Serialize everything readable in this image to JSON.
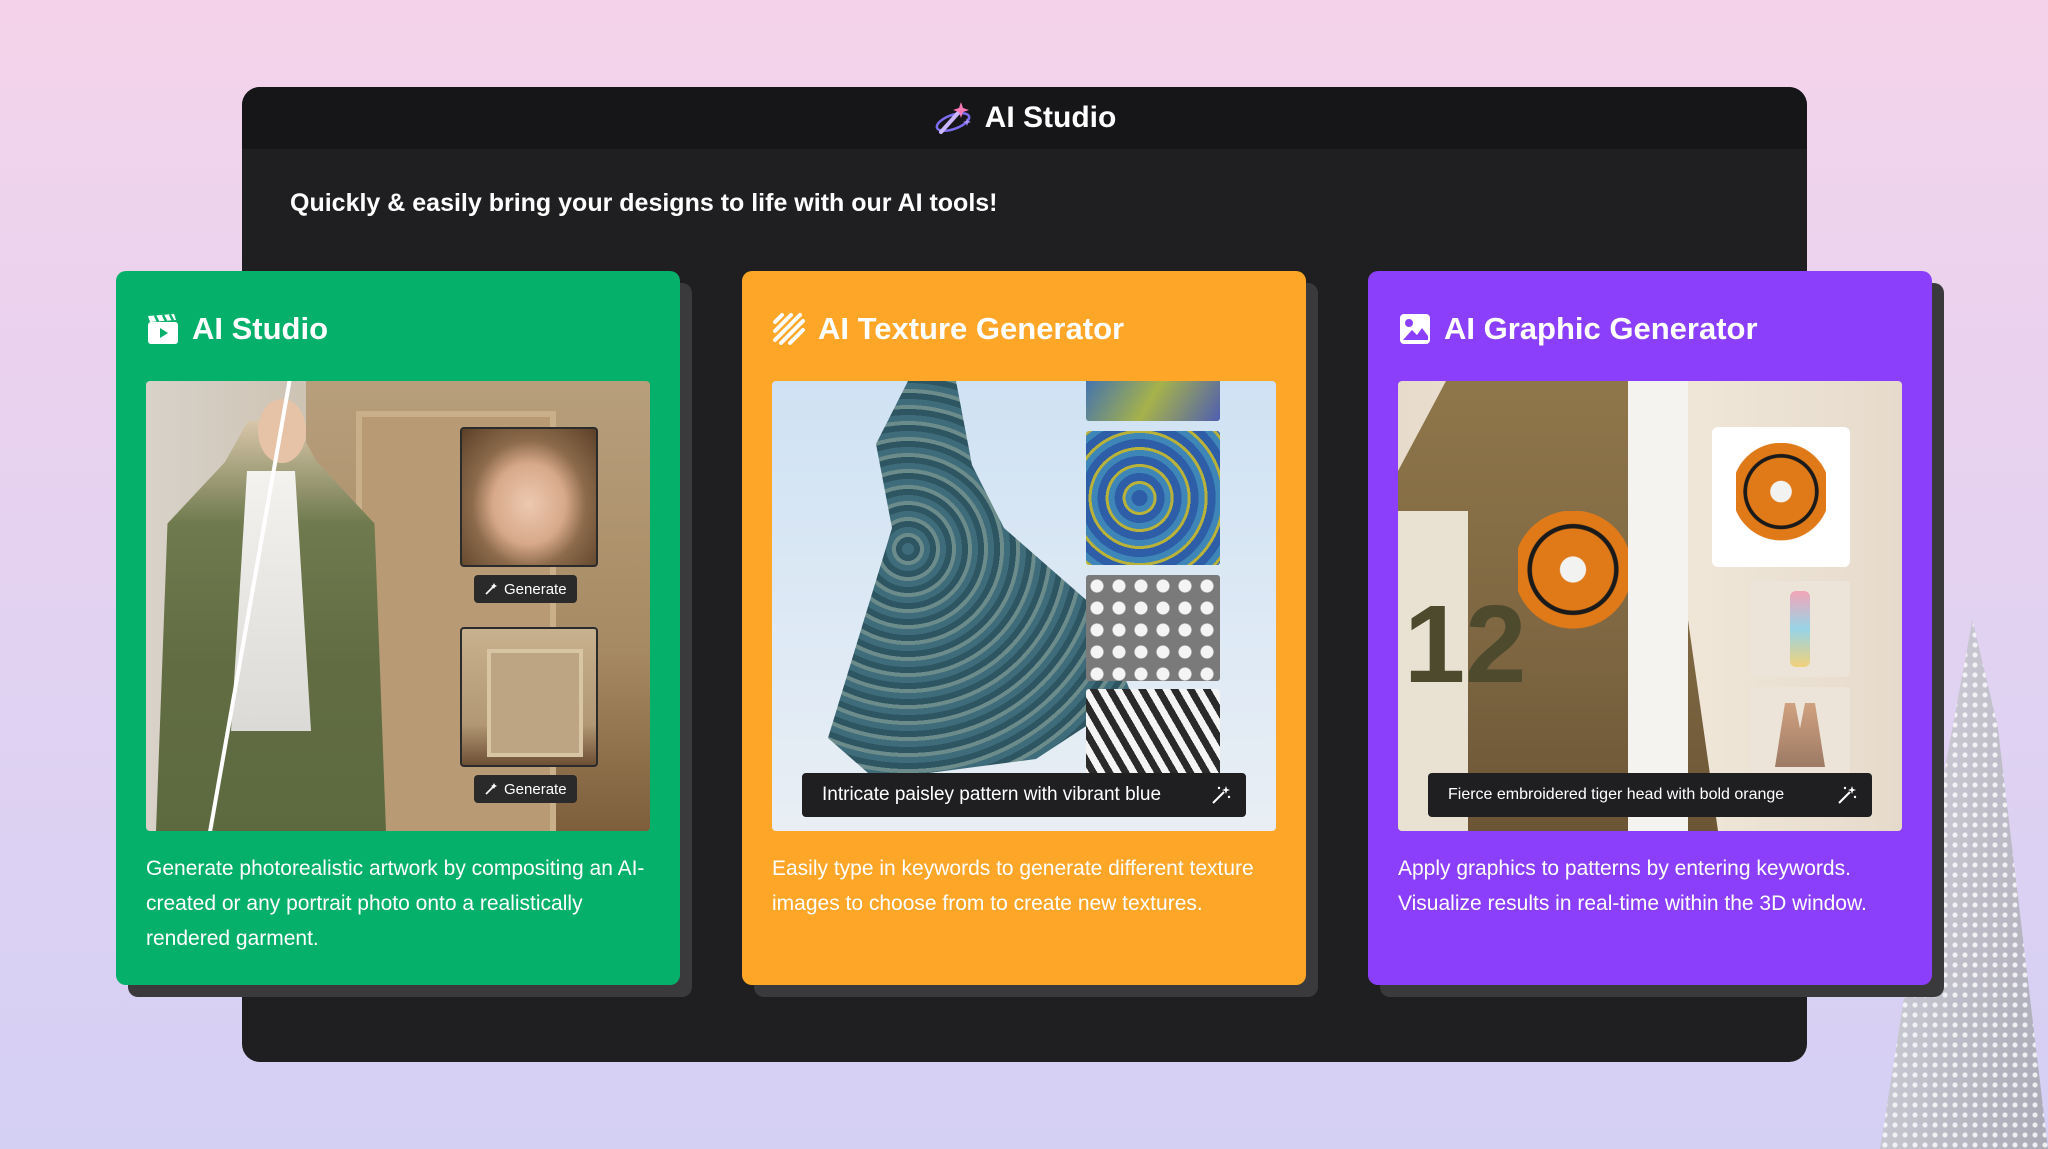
{
  "window": {
    "title": "AI Studio",
    "tagline": "Quickly & easily bring your designs to life with our AI tools!"
  },
  "cards": [
    {
      "title": "AI Studio",
      "icon": "film-clapper-icon",
      "color": "#05b06a",
      "buttons": [
        "Generate",
        "Generate"
      ],
      "description": "Generate photorealistic artwork by compositing an AI-created or any portrait photo onto a realistically rendered garment."
    },
    {
      "title": "AI Texture Generator",
      "icon": "texture-lines-icon",
      "color": "#fda628",
      "prompt": "Intricate paisley pattern with vibrant blue",
      "description": "Easily type in keywords to generate different texture images to choose from to create new textures."
    },
    {
      "title": "AI Graphic Generator",
      "icon": "image-graphic-icon",
      "color": "#8c3ffb",
      "prompt": "Fierce embroidered tiger head with bold orange",
      "jacket_number": "12",
      "description": "Apply graphics to patterns by entering keywords. Visualize results in real-time within the 3D window."
    }
  ]
}
